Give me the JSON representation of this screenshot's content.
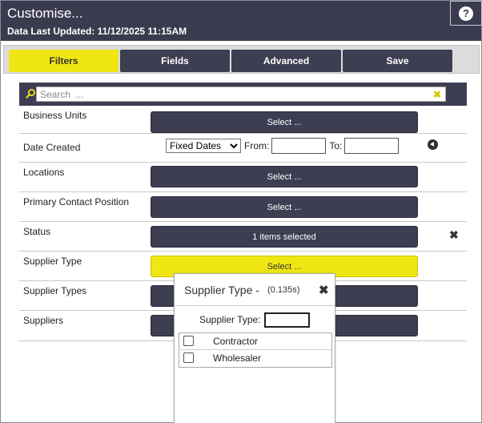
{
  "window": {
    "title": "Customise...",
    "data_updated": "Data Last Updated: 11/12/2025 11:15AM",
    "help_symbol": "?"
  },
  "tabs": [
    {
      "label": "Filters",
      "active": true
    },
    {
      "label": "Fields",
      "active": false
    },
    {
      "label": "Advanced",
      "active": false
    },
    {
      "label": "Save",
      "active": false
    }
  ],
  "search": {
    "placeholder": "Search  ...",
    "value": "",
    "icon": "search-icon",
    "clear_symbol": "✖"
  },
  "filters": {
    "business_units": {
      "label": "Business Units",
      "button": "Select ..."
    },
    "date_created": {
      "label": "Date Created",
      "mode": "Fixed Dates",
      "options": [
        "Fixed Dates"
      ],
      "from_label": "From:",
      "from_value": "",
      "to_label": "To:",
      "to_value": ""
    },
    "locations": {
      "label": "Locations",
      "button": "Select ..."
    },
    "primary_contact_position": {
      "label": "Primary Contact Position",
      "button": "Select ..."
    },
    "status": {
      "label": "Status",
      "button": "1 items selected",
      "clear_symbol": "✖"
    },
    "supplier_type": {
      "label": "Supplier Type",
      "button": "Select ..."
    },
    "supplier_types": {
      "label": "Supplier Types",
      "button": ""
    },
    "suppliers": {
      "label": "Suppliers",
      "button": ""
    }
  },
  "popup": {
    "title": "Supplier Type -",
    "time": "(0.135s)",
    "close_symbol": "✖",
    "filter_label": "Supplier Type:",
    "filter_value": "",
    "options": [
      {
        "label": "Contractor",
        "checked": false
      },
      {
        "label": "Wholesaler",
        "checked": false
      }
    ]
  },
  "colors": {
    "header_bg": "#3b3b4f",
    "button_bg": "#3e3e52",
    "accent_yellow": "#f0e614"
  }
}
